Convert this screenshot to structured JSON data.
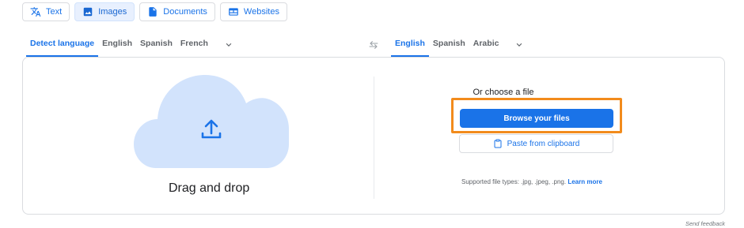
{
  "tabs": [
    {
      "label": "Text",
      "icon": "translate-icon"
    },
    {
      "label": "Images",
      "icon": "image-icon"
    },
    {
      "label": "Documents",
      "icon": "document-icon"
    },
    {
      "label": "Websites",
      "icon": "website-icon"
    }
  ],
  "source_langs": [
    "Detect language",
    "English",
    "Spanish",
    "French"
  ],
  "target_langs": [
    "English",
    "Spanish",
    "Arabic"
  ],
  "upload": {
    "drag_text": "Drag and drop",
    "choose_text": "Or choose a file",
    "browse_label": "Browse your files",
    "paste_label": "Paste from clipboard",
    "supported_text": "Supported file types: .jpg, .jpeg, .png.",
    "learn_more": "Learn more"
  },
  "feedback": "Send feedback",
  "colors": {
    "accent": "#1a73e8",
    "cloud": "#d2e3fc",
    "highlight": "#f28b1c"
  }
}
